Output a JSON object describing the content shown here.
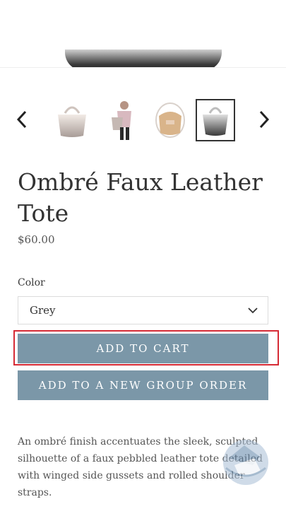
{
  "product": {
    "title": "Ombré Faux Leather Tote",
    "price": "$60.00",
    "color_label": "Color",
    "color_value": "Grey",
    "description": "An ombré finish accentuates the sleek, sculpted silhouette of a faux pebbled leather tote detailed with winged side gussets and rolled shoulder straps."
  },
  "buttons": {
    "add_to_cart": "ADD TO CART",
    "group_order": "ADD TO A NEW GROUP ORDER"
  },
  "gallery": {
    "thumbnail_count": 4,
    "selected_index": 4
  },
  "icons": {
    "prev": "chevron-left-icon",
    "next": "chevron-right-icon",
    "select": "chevron-down-icon"
  },
  "colors": {
    "button": "#7b97a8",
    "highlight": "#d62a35",
    "text": "#333333"
  }
}
